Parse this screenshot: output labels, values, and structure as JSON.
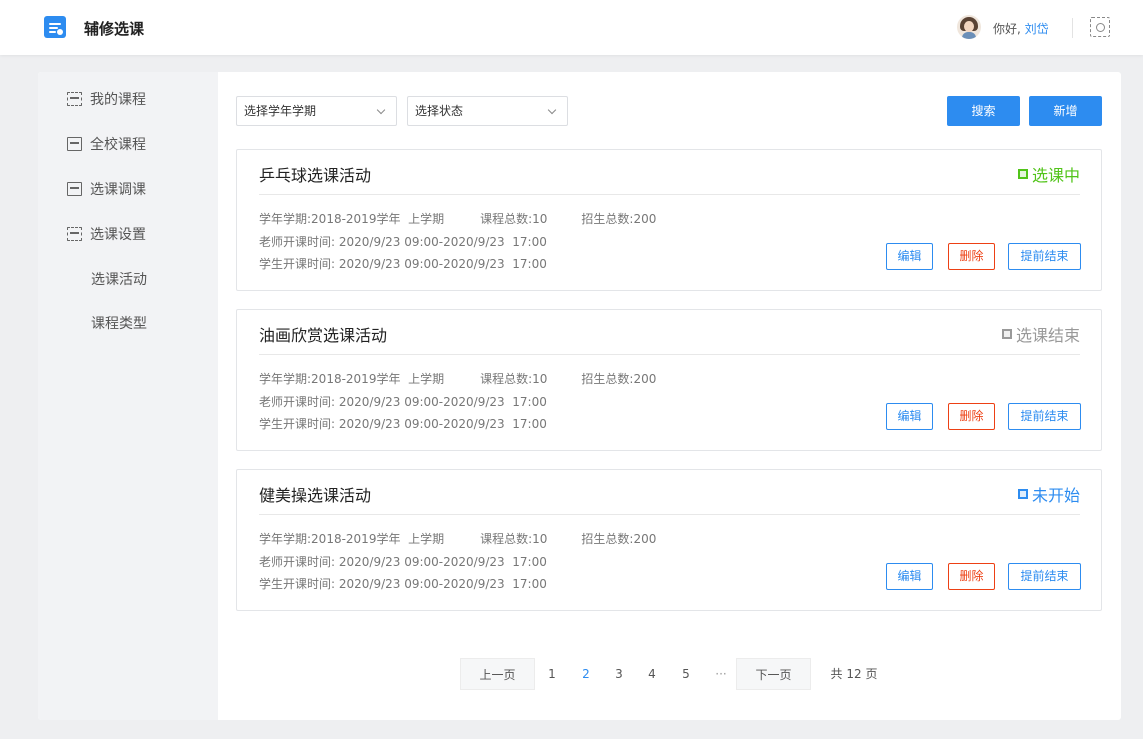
{
  "header": {
    "app_title": "辅修选课",
    "greeting": "你好,",
    "user_name": "刘岱"
  },
  "sidebar": {
    "items": [
      {
        "label": "我的课程",
        "icon": "my-courses-icon"
      },
      {
        "label": "全校课程",
        "icon": "school-courses-icon"
      },
      {
        "label": "选课调课",
        "icon": "course-adjust-icon"
      },
      {
        "label": "选课设置",
        "icon": "course-settings-icon"
      }
    ],
    "sub_items": [
      {
        "label": "选课活动"
      },
      {
        "label": "课程类型"
      }
    ]
  },
  "filters": {
    "term_select": "选择学年学期",
    "status_select": "选择状态",
    "search_label": "搜索",
    "add_label": "新增"
  },
  "labels": {
    "term_prefix": "学年学期:",
    "total_courses_prefix": "课程总数:",
    "total_enroll_prefix": "招生总数:",
    "teacher_time_prefix": "老师开课时间:",
    "student_time_prefix": "学生开课时间:",
    "edit": "编辑",
    "delete": "删除",
    "end_early": "提前结束"
  },
  "activities": [
    {
      "title": "乒乓球选课活动",
      "status": "选课中",
      "status_color": "#52c41a",
      "term": "2018-2019学年  上学期",
      "total_courses": "10",
      "total_enroll": "200",
      "teacher_time": "2020/9/23 09:00-2020/9/23  17:00",
      "student_time": "2020/9/23 09:00-2020/9/23  17:00"
    },
    {
      "title": "油画欣赏选课活动",
      "status": "选课结束",
      "status_color": "#999999",
      "term": "2018-2019学年  上学期",
      "total_courses": "10",
      "total_enroll": "200",
      "teacher_time": "2020/9/23 09:00-2020/9/23  17:00",
      "student_time": "2020/9/23 09:00-2020/9/23  17:00"
    },
    {
      "title": "健美操选课活动",
      "status": "未开始",
      "status_color": "#2d8cf0",
      "term": "2018-2019学年  上学期",
      "total_courses": "10",
      "total_enroll": "200",
      "teacher_time": "2020/9/23 09:00-2020/9/23  17:00",
      "student_time": "2020/9/23 09:00-2020/9/23  17:00"
    }
  ],
  "pagination": {
    "prev": "上一页",
    "next": "下一页",
    "pages": [
      "1",
      "2",
      "3",
      "4",
      "5"
    ],
    "current": "2",
    "ellipsis": "···",
    "total": "共 12 页"
  }
}
